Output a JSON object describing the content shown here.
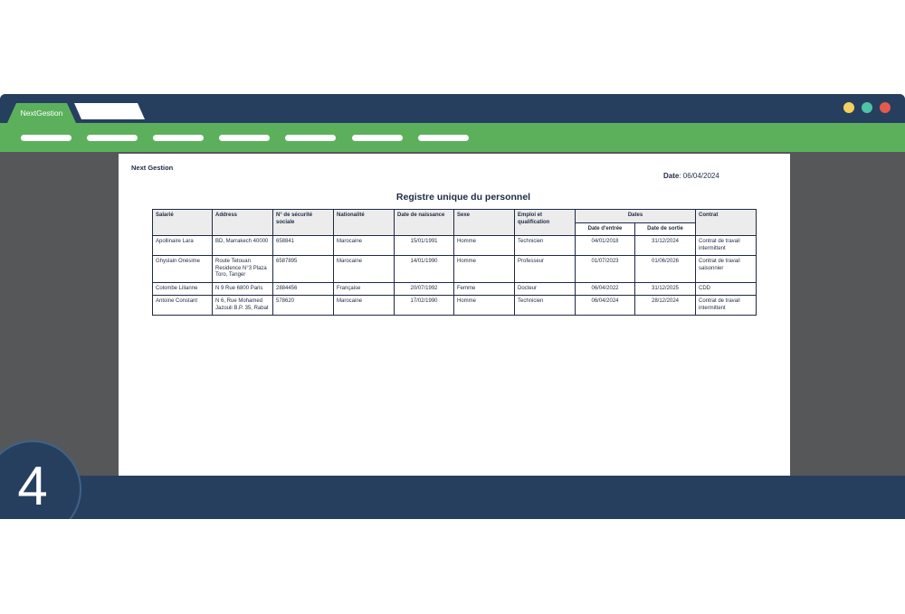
{
  "browser": {
    "tab_active_label": "NextGestion",
    "window_buttons": [
      "minimize-dot",
      "maximize-dot",
      "close-dot"
    ],
    "colors": {
      "titlebar": "#263f5f",
      "navbar": "#5cb05c",
      "yellow": "#f4d060",
      "teal": "#4ec3a6",
      "red": "#e6594c"
    }
  },
  "document": {
    "company": "Next Gestion",
    "date_label": "Date",
    "date_value": ": 06/04/2024",
    "title": "Registre unique du personnel",
    "headers": {
      "salarie": "Salarié",
      "address": "Address",
      "securite": "N° de sécurité sociale",
      "nationalite": "Nationalité",
      "naissance": "Date de naissance",
      "sexe": "Sexe",
      "emploi": "Emploi et qualification",
      "dates": "Dates",
      "entree": "Date d'entrée",
      "sortie": "Date de sortie",
      "contrat": "Contrat"
    },
    "rows": [
      {
        "salarie": "Apollinaire Lara",
        "address": "BD, Marrakech 40000",
        "securite": "658841",
        "nationalite": "Marocaine",
        "naissance": "15/01/1991",
        "sexe": "Homme",
        "emploi": "Technicien",
        "entree": "04/01/2018",
        "sortie": "31/12/2024",
        "contrat": "Contrat de travail intermittent"
      },
      {
        "salarie": "Ghyslain Onésime",
        "address": "Route Tetouan Residence N°3 Plaza Toro, Tanger",
        "securite": "6587895",
        "nationalite": "Marocaine",
        "naissance": "14/01/1990",
        "sexe": "Homme",
        "emploi": "Professeur",
        "entree": "01/07/2023",
        "sortie": "01/06/2026",
        "contrat": "Contrat de travail saisonnier"
      },
      {
        "salarie": "Colombe Lilianne",
        "address": "N 9 Rue 6800 Paris",
        "securite": "2884456",
        "nationalite": "Française",
        "naissance": "20/07/1992",
        "sexe": "Femme",
        "emploi": "Docteur",
        "entree": "06/04/2022",
        "sortie": "31/12/2025",
        "contrat": "CDD"
      },
      {
        "salarie": "Antoine Constant",
        "address": "N 6, Rue Mohamed Jazouli B.P. 35, Rabat",
        "securite": "578620",
        "nationalite": "Marocaine",
        "naissance": "17/02/1990",
        "sexe": "Homme",
        "emploi": "Technicien",
        "entree": "06/04/2024",
        "sortie": "28/12/2024",
        "contrat": "Contrat de travail intermittent"
      }
    ]
  },
  "step": {
    "number": "4"
  }
}
